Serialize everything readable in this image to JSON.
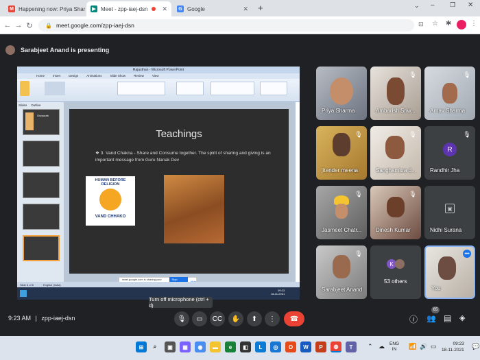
{
  "browser": {
    "tabs": [
      {
        "label": "Happening now: Priya Sharma is"
      },
      {
        "label": "Meet - zpp-iaej-dsn"
      },
      {
        "label": "Google"
      }
    ],
    "url": "meet.google.com/zpp-iaej-dsn"
  },
  "meet": {
    "presenting_text": "Sarabjeet Anand is presenting",
    "time": "9:23 AM",
    "meeting_code": "zpp-iaej-dsn",
    "tooltip": "Turn off microphone (ctrl + d)",
    "participant_count": "65",
    "participants": [
      {
        "name": "Priya Sharma"
      },
      {
        "name": "Ambarish Sriw..."
      },
      {
        "name": "Arnav Sharma"
      },
      {
        "name": "jitender meena"
      },
      {
        "name": "Sanghamitra d..."
      },
      {
        "name": "Randhir Jha",
        "initial": "R"
      },
      {
        "name": "Jasmeet Chatr..."
      },
      {
        "name": "Dinesh Kumar"
      },
      {
        "name": "Nidhi Surana"
      },
      {
        "name": "Sarabjeet Anand"
      },
      {
        "name": "53 others",
        "initial": "K"
      },
      {
        "name": "You"
      }
    ]
  },
  "slide": {
    "app_title": "Rajasthan - Microsoft PowerPoint",
    "ribbon_tabs": [
      "Home",
      "Insert",
      "Design",
      "Animations",
      "Slide Show",
      "Review",
      "View"
    ],
    "panel_tabs": [
      "Slides",
      "Outline"
    ],
    "title": "Teachings",
    "bullet": "3. Vand Chakna - Share and Consume together. The spirit of sharing and giving is an important message from Guru Nanak Dev",
    "logo_top": "HUMAN BEFORE RELIGION",
    "logo_bottom": "VAND CHHAKO",
    "thumb_title": "Gurpurab",
    "share_notice": "meet.google.com is sharing your screen.",
    "share_stop": "Stop sharing",
    "share_hide": "Hide",
    "status_left": "Slide 6 of 6",
    "status_lang": "English (India)",
    "clock_time": "09:23",
    "clock_date": "18-11-2021"
  },
  "taskbar": {
    "lang_top": "ENG",
    "lang_bottom": "IN",
    "time": "09:23",
    "date": "18-11-2021"
  },
  "colors": {
    "end_call": "#ea4335",
    "meet_bg": "#202124",
    "slide_dark": "#2d2d2d"
  }
}
